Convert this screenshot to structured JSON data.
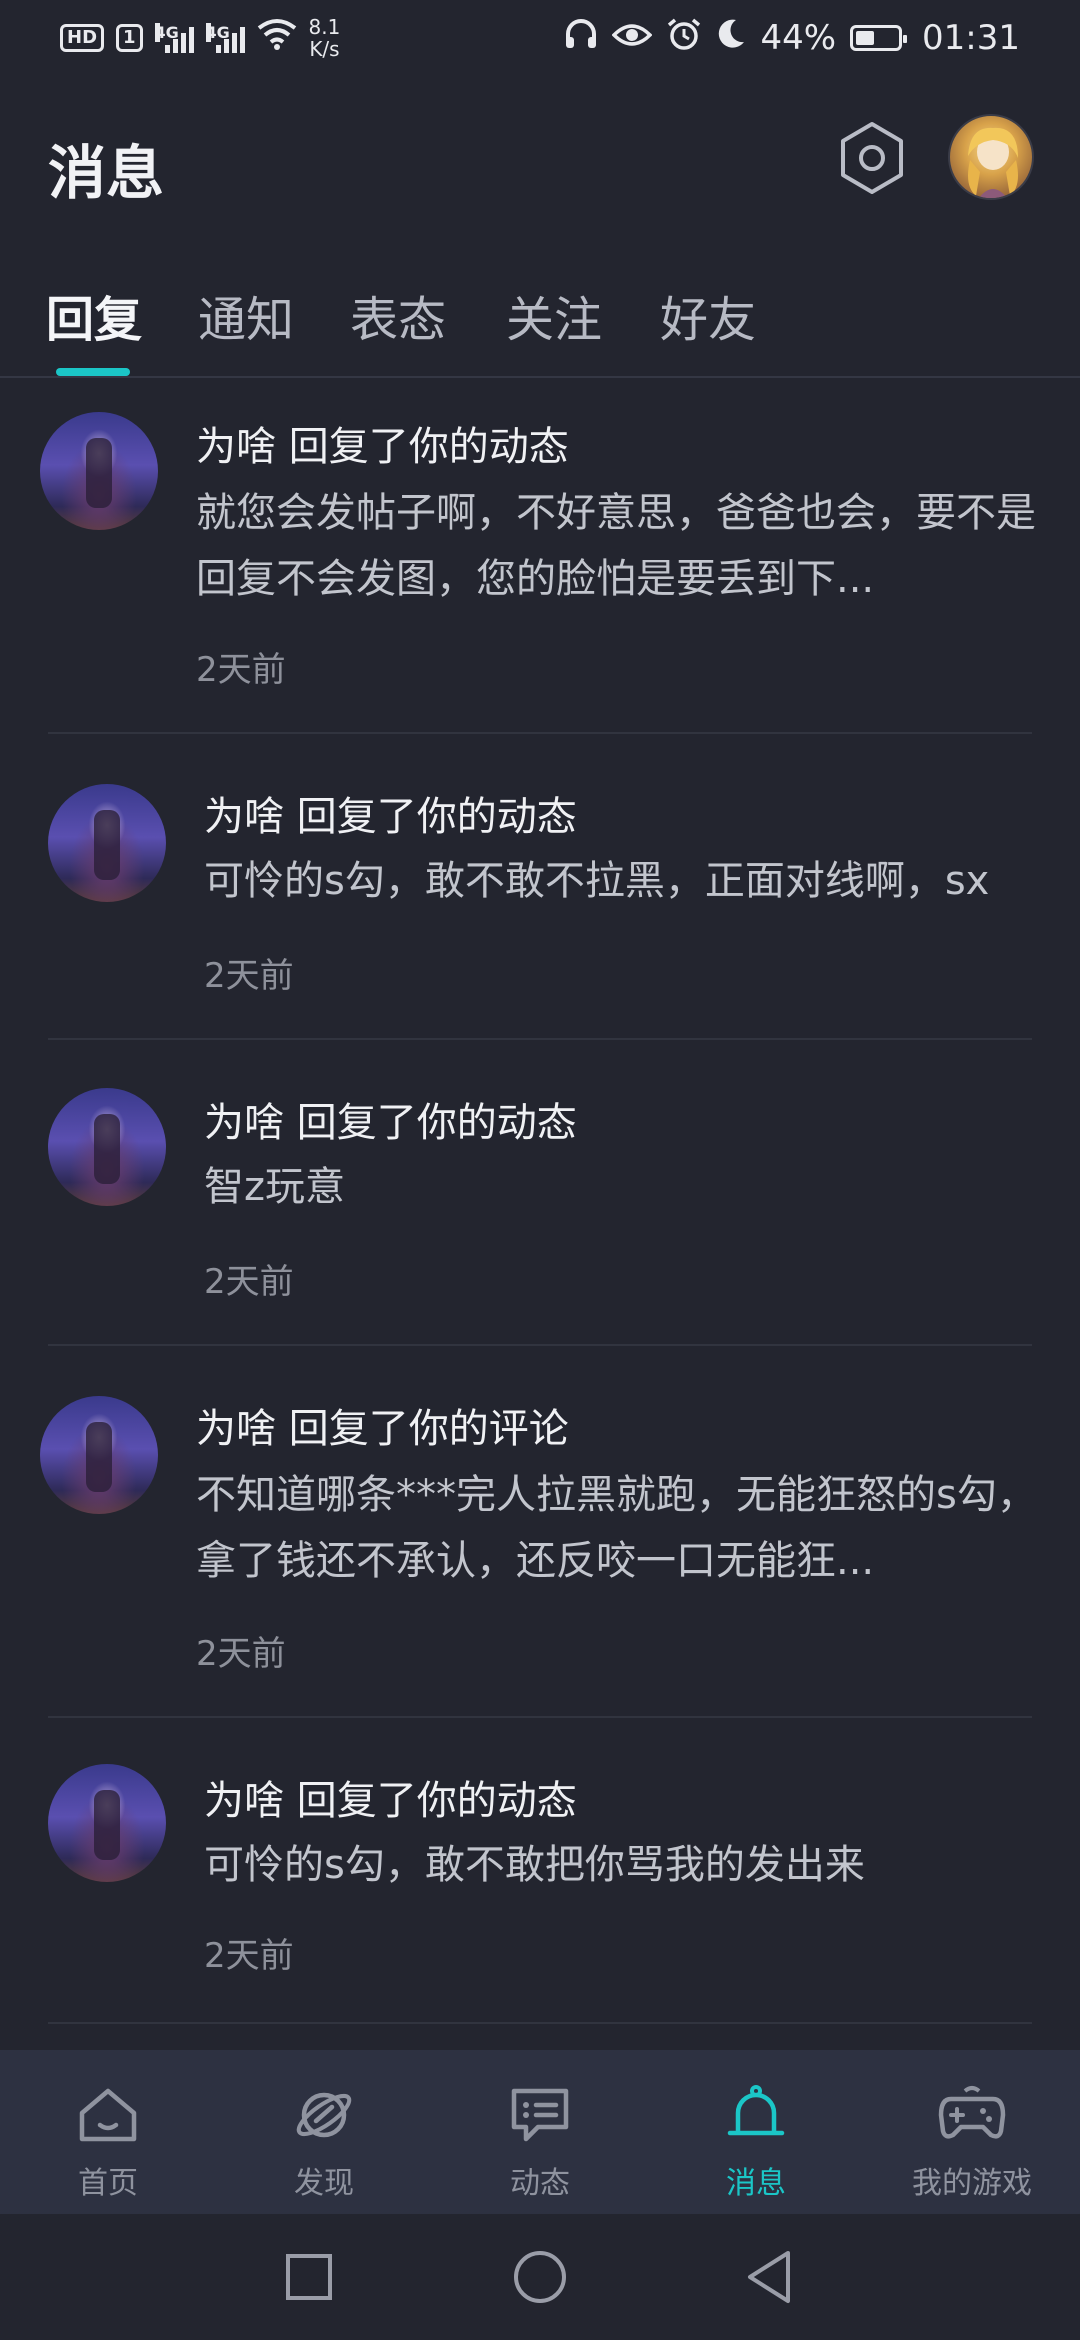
{
  "status_bar": {
    "hd": "HD",
    "sim": "1",
    "net1": "4G",
    "net2": "4G",
    "speed_value": "8.1",
    "speed_unit": "K/s",
    "battery": "44%",
    "battery_level": 0.44,
    "time": "01:31"
  },
  "header": {
    "title": "消息",
    "settings_icon": "hexagon-gear-icon",
    "avatar_icon": "user-avatar"
  },
  "tabs": {
    "items": [
      {
        "label": "回复",
        "active": true
      },
      {
        "label": "通知"
      },
      {
        "label": "表态"
      },
      {
        "label": "关注"
      },
      {
        "label": "好友"
      }
    ],
    "accent": "#1bc6c7"
  },
  "messages": [
    {
      "title": "为啥 回复了你的动态",
      "body": "就您会发帖子啊，不好意思，爸爸也会，要不是回复不会发图，您的脸怕是要丢到下...",
      "time": "2天前"
    },
    {
      "title": "为啥 回复了你的动态",
      "body": "可怜的s勾，敢不敢不拉黑，正面对线啊，sx",
      "time": "2天前"
    },
    {
      "title": "为啥 回复了你的动态",
      "body": "智z玩意",
      "time": "2天前"
    },
    {
      "title": "为啥 回复了你的评论",
      "body": "不知道哪条***完人拉黑就跑，无能狂怒的s勾，拿了钱还不承认，还反咬一口无能狂...",
      "time": "2天前"
    },
    {
      "title": "为啥 回复了你的动态",
      "body": "可怜的s勾，敢不敢把你骂我的发出来",
      "time": "2天前"
    }
  ],
  "bottom_nav": {
    "items": [
      {
        "label": "首页",
        "icon": "home-icon"
      },
      {
        "label": "发现",
        "icon": "planet-icon"
      },
      {
        "label": "动态",
        "icon": "chat-bubble-icon"
      },
      {
        "label": "消息",
        "icon": "bell-icon",
        "active": true
      },
      {
        "label": "我的游戏",
        "icon": "gamepad-icon"
      }
    ]
  },
  "system_nav": {
    "recent": "square-icon",
    "home": "circle-icon",
    "back": "triangle-back-icon"
  },
  "colors": {
    "background": "#23252f",
    "nav_background": "#2d3141",
    "accent": "#1bc6c7"
  }
}
